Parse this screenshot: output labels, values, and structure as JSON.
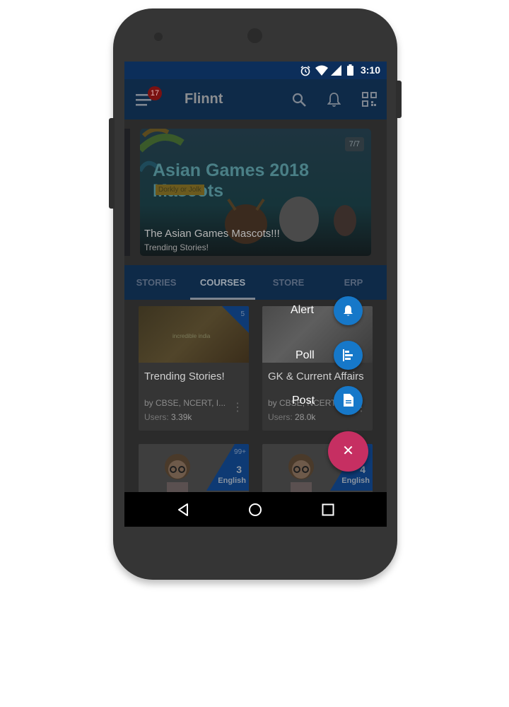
{
  "status": {
    "time": "3:10"
  },
  "appbar": {
    "title": "Flinnt",
    "badge": "17"
  },
  "banner": {
    "counter": "7/7",
    "headline": "Asian Games 2018 Mascots",
    "tag": "Dorkly or Jolk",
    "title": "The Asian Games Mascots!!!",
    "subtitle": "Trending Stories!"
  },
  "tabs": [
    {
      "label": "STORIES"
    },
    {
      "label": "COURSES"
    },
    {
      "label": "STORE"
    },
    {
      "label": "ERP"
    }
  ],
  "cards": [
    {
      "title": "Trending Stories!",
      "by": "by CBSE, NCERT, I...",
      "users_label": "Users:",
      "users": "3.39k",
      "count": "5",
      "thumb_text": "incredible india"
    },
    {
      "title": "GK & Current Affairs",
      "by": "by CBSE, NCERT,",
      "users_label": "Users:",
      "users": "28.0k",
      "count": ""
    },
    {
      "title": "",
      "count": "99+",
      "grade": "3",
      "subject": "English"
    },
    {
      "title": "",
      "count": "",
      "grade": "4",
      "subject": "English"
    }
  ],
  "fab": {
    "main": "✕",
    "actions": [
      {
        "label": "Alert",
        "icon": "bell-icon"
      },
      {
        "label": "Poll",
        "icon": "poll-icon"
      },
      {
        "label": "Post",
        "icon": "document-icon"
      }
    ]
  },
  "colors": {
    "fab_main": "#ff4081",
    "fab_mini": "#1e88e5",
    "appbar": "#1565c0"
  }
}
